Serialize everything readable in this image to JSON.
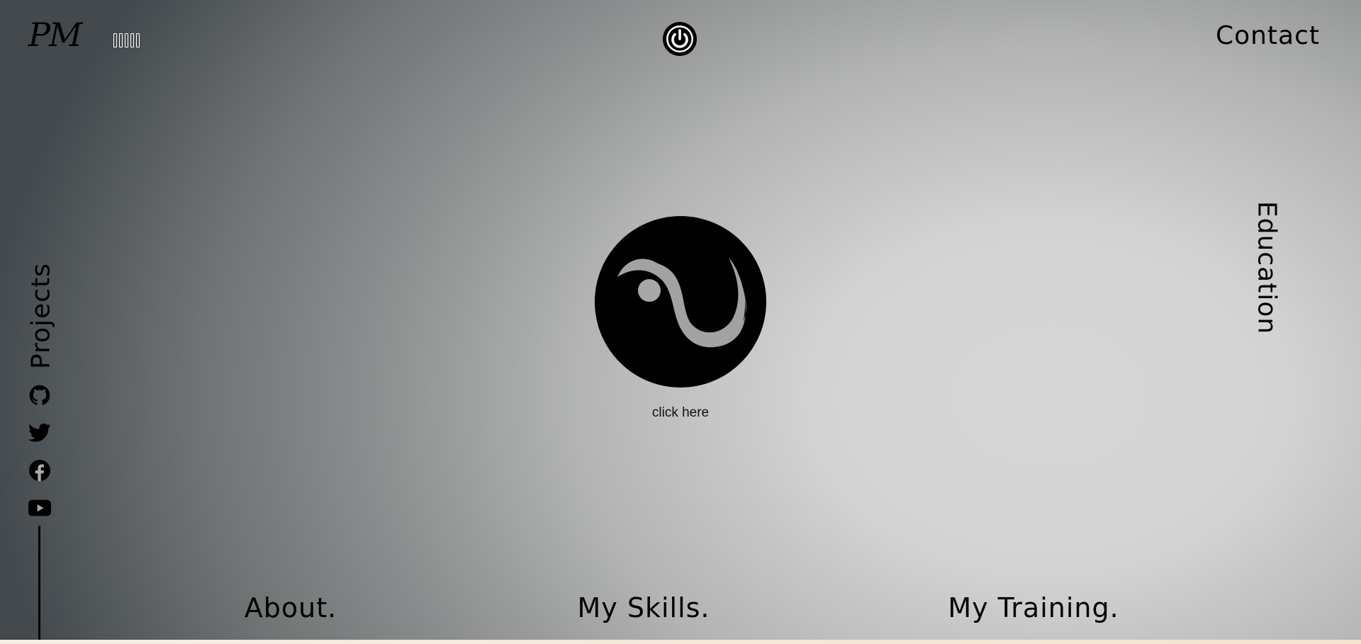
{
  "header": {
    "logo_text": "PM",
    "menu_glyphs": [
      "",
      "",
      "",
      "",
      ""
    ],
    "power_icon": "power-icon",
    "contact_label": "Contact"
  },
  "side_links": {
    "education_label": "Education",
    "projects_label": "Projects"
  },
  "social": {
    "icons": [
      "github-icon",
      "twitter-icon",
      "facebook-icon",
      "youtube-icon"
    ]
  },
  "center": {
    "symbol_icon": "yin-yang-icon",
    "click_here_label": "click here"
  },
  "bottom_nav": {
    "about_label": "About.",
    "skills_label": "My Skills.",
    "training_label": "My Training."
  },
  "colors": {
    "background_dark": "#43494d",
    "background_light": "#d7d7d7",
    "text": "#000000",
    "bottom_strip": "#f3e4d0"
  }
}
